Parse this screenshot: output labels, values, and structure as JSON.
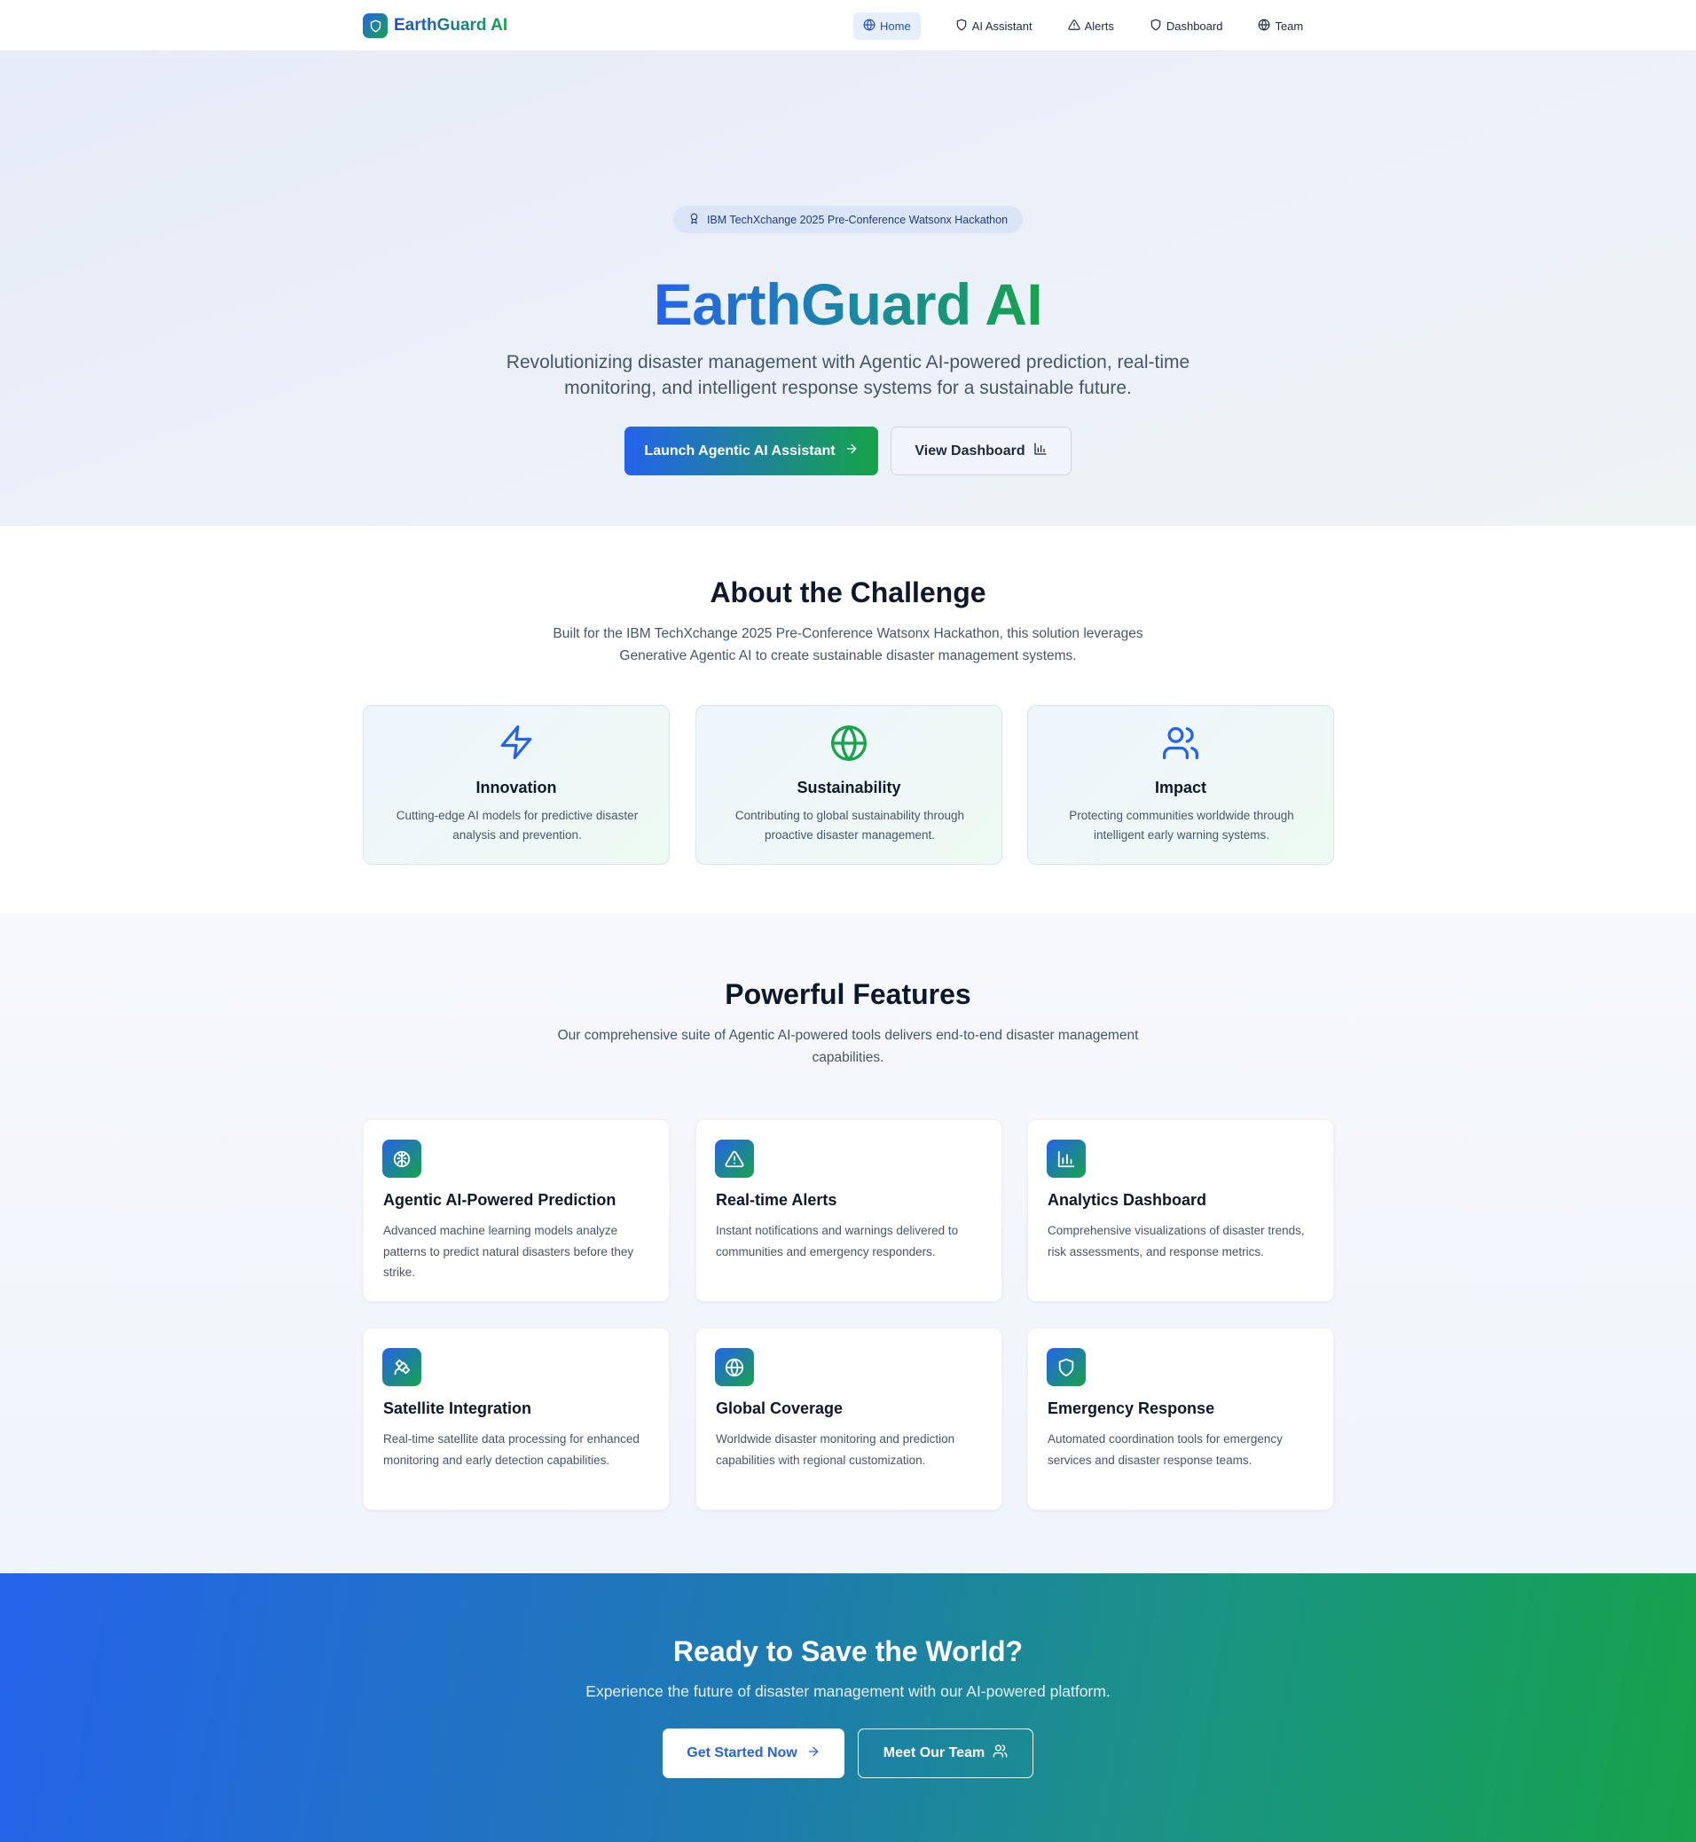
{
  "brand": {
    "name": "EarthGuard AI"
  },
  "nav": {
    "items": [
      {
        "label": "Home",
        "icon": "globe-icon",
        "active": true
      },
      {
        "label": "AI Assistant",
        "icon": "shield-icon"
      },
      {
        "label": "Alerts",
        "icon": "alert-triangle-icon"
      },
      {
        "label": "Dashboard",
        "icon": "shield-icon"
      },
      {
        "label": "Team",
        "icon": "globe-icon"
      }
    ]
  },
  "hero": {
    "badge": "IBM TechXchange 2025 Pre-Conference Watsonx Hackathon",
    "title": "EarthGuard AI",
    "subtitle": "Revolutionizing disaster management with Agentic AI-powered prediction, real-time monitoring, and intelligent response systems for a sustainable future.",
    "primary_button": "Launch Agentic AI Assistant",
    "secondary_button": "View Dashboard"
  },
  "about": {
    "title": "About the Challenge",
    "subtitle": "Built for the IBM TechXchange 2025 Pre-Conference Watsonx Hackathon, this solution leverages Generative Agentic AI to create sustainable disaster management systems.",
    "cards": [
      {
        "title": "Innovation",
        "description": "Cutting-edge AI models for predictive disaster analysis and prevention.",
        "icon": "zap-icon",
        "color": "#2563eb"
      },
      {
        "title": "Sustainability",
        "description": "Contributing to global sustainability through proactive disaster management.",
        "icon": "globe-icon",
        "color": "#16a34a"
      },
      {
        "title": "Impact",
        "description": "Protecting communities worldwide through intelligent early warning systems.",
        "icon": "users-icon",
        "color": "#2563eb"
      }
    ]
  },
  "features": {
    "title": "Powerful Features",
    "subtitle": "Our comprehensive suite of Agentic AI-powered tools delivers end-to-end disaster management capabilities.",
    "cards": [
      {
        "title": "Agentic AI-Powered Prediction",
        "description": "Advanced machine learning models analyze patterns to predict natural disasters before they strike.",
        "icon": "brain-icon"
      },
      {
        "title": "Real-time Alerts",
        "description": "Instant notifications and warnings delivered to communities and emergency responders.",
        "icon": "alert-triangle-icon"
      },
      {
        "title": "Analytics Dashboard",
        "description": "Comprehensive visualizations of disaster trends, risk assessments, and response metrics.",
        "icon": "bar-chart-icon"
      },
      {
        "title": "Satellite Integration",
        "description": "Real-time satellite data processing for enhanced monitoring and early detection capabilities.",
        "icon": "satellite-icon"
      },
      {
        "title": "Global Coverage",
        "description": "Worldwide disaster monitoring and prediction capabilities with regional customization.",
        "icon": "globe-icon"
      },
      {
        "title": "Emergency Response",
        "description": "Automated coordination tools for emergency services and disaster response teams.",
        "icon": "shield-icon"
      }
    ]
  },
  "cta": {
    "title": "Ready to Save the World?",
    "subtitle": "Experience the future of disaster management with our AI-powered platform.",
    "primary_button": "Get Started Now",
    "secondary_button": "Meet Our Team"
  },
  "colors": {
    "primary": "#2563eb",
    "secondary": "#16a34a",
    "heading": "#0f172a",
    "body": "#475569"
  }
}
